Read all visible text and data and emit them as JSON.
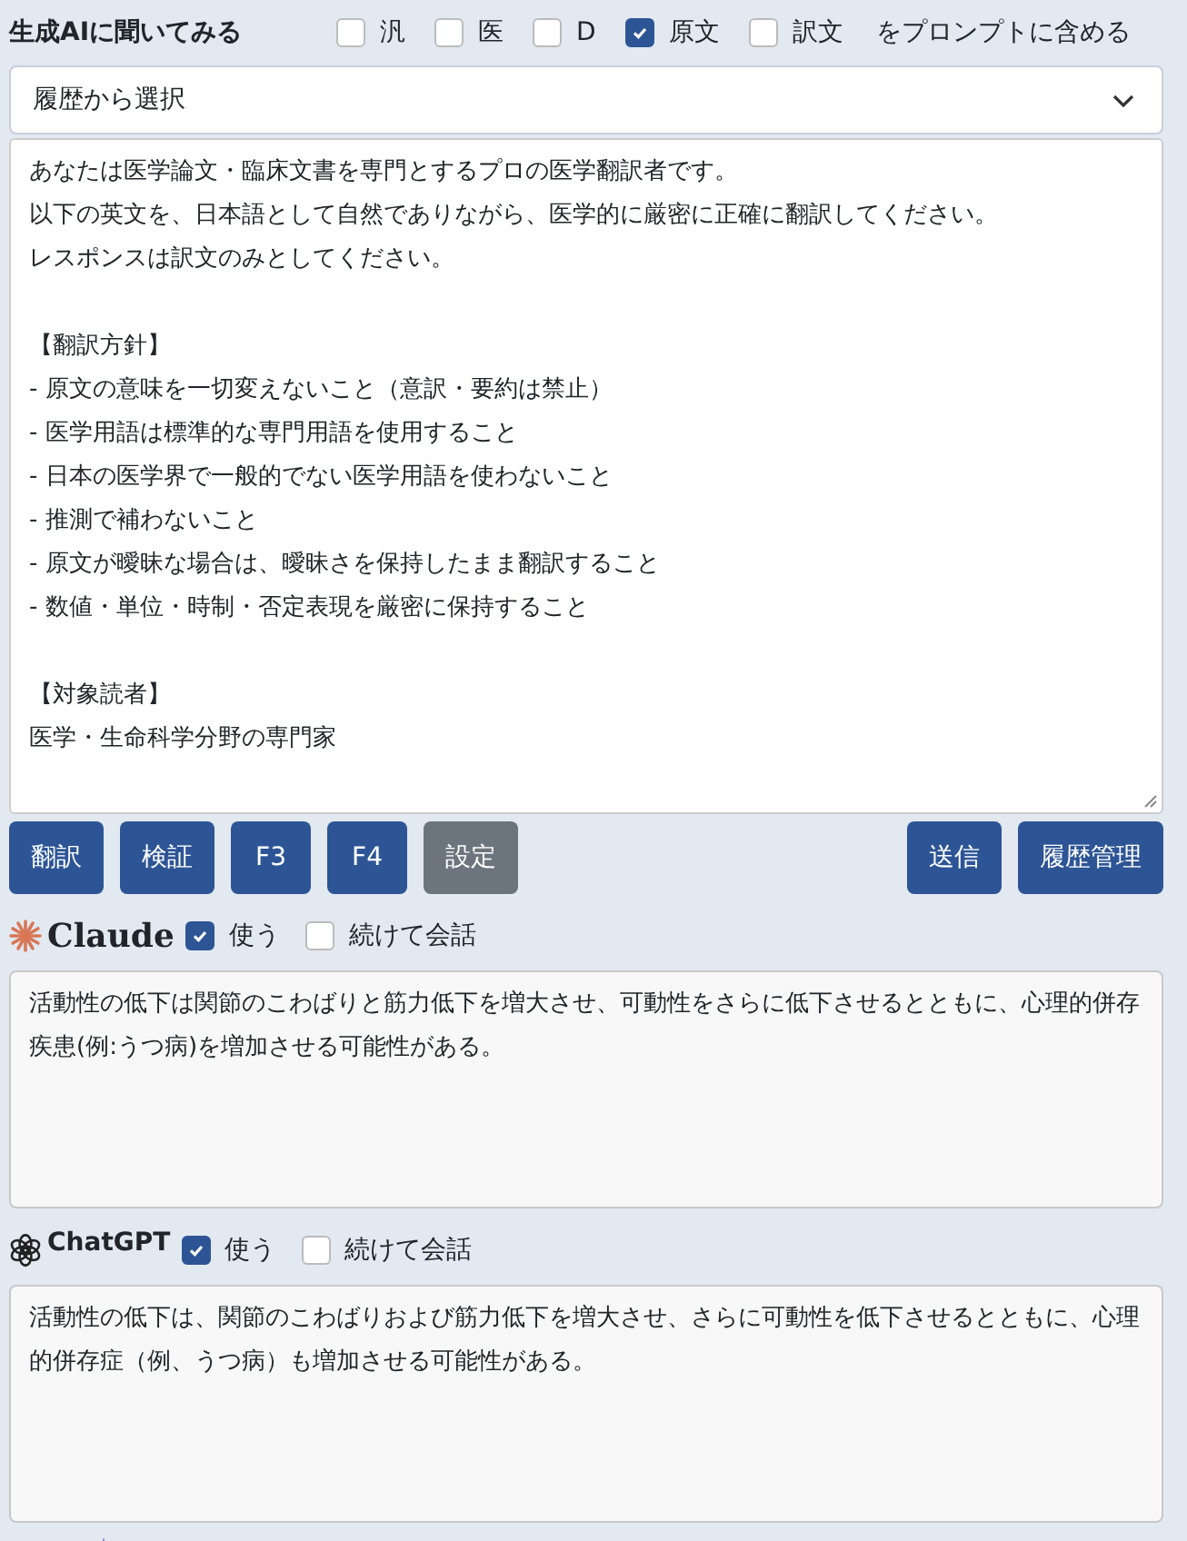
{
  "header": {
    "title": "生成AIに聞いてみる",
    "options": [
      {
        "label": "汎",
        "checked": false
      },
      {
        "label": "医",
        "checked": false
      },
      {
        "label": "D",
        "checked": false
      },
      {
        "label": "原文",
        "checked": true
      },
      {
        "label": "訳文",
        "checked": false
      }
    ],
    "suffix": "をプロンプトに含める"
  },
  "history_select": {
    "value": "履歴から選択"
  },
  "prompt": {
    "paragraphs": [
      [
        "あなたは医学論文・臨床文書を専門とするプロの医学翻訳者です。",
        "以下の英文を、日本語として自然でありながら、医学的に厳密に正確に翻訳してください。",
        "レスポンスは訳文のみとしてください。"
      ],
      [
        "【翻訳方針】",
        "- 原文の意味を一切変えないこと（意訳・要約は禁止）",
        "- 医学用語は標準的な専門用語を使用すること",
        "- 日本の医学界で一般的でない医学用語を使わないこと",
        "- 推測で補わないこと",
        "- 原文が曖昧な場合は、曖昧さを保持したまま翻訳すること",
        "- 数値・単位・時制・否定表現を厳密に保持すること"
      ],
      [
        "【対象読者】",
        "医学・生命科学分野の専門家"
      ]
    ]
  },
  "left_buttons": [
    {
      "label": "翻訳",
      "kind": "primary"
    },
    {
      "label": "検証",
      "kind": "primary"
    },
    {
      "label": "F3",
      "kind": "primary"
    },
    {
      "label": "F4",
      "kind": "primary"
    },
    {
      "label": "設定",
      "kind": "secondary"
    }
  ],
  "right_buttons": [
    {
      "label": "送信",
      "kind": "primary"
    },
    {
      "label": "履歴管理",
      "kind": "primary"
    }
  ],
  "assistants": [
    {
      "kind": "claude",
      "name": "Claude",
      "use": {
        "label": "使う",
        "checked": true
      },
      "continue": {
        "label": "続けて会話",
        "checked": false
      },
      "response": "活動性の低下は関節のこわばりと筋力低下を増大させ、可動性をさらに低下させるとともに、心理的併存疾患(例:うつ病)を増加させる可能性がある。"
    },
    {
      "kind": "chatgpt",
      "name": "ChatGPT",
      "use": {
        "label": "使う",
        "checked": true
      },
      "continue": {
        "label": "続けて会話",
        "checked": false
      },
      "response": "活動性の低下は、関節のこわばりおよび筋力低下を増大させ、さらに可動性を低下させるとともに、心理的併存症（例、うつ病）も増加させる可能性がある。"
    }
  ]
}
